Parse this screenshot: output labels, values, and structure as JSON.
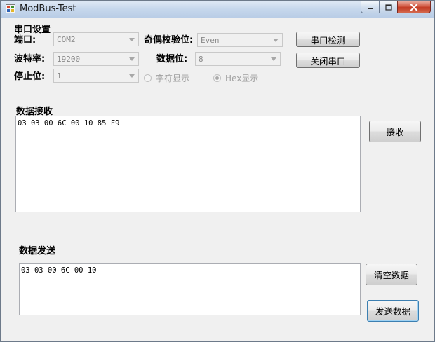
{
  "window": {
    "title": "ModBus-Test"
  },
  "serial_settings": {
    "group_title": "串口设置",
    "port_label": "端口:",
    "port_value": "COM2",
    "baud_label": "波特率:",
    "baud_value": "19200",
    "stop_label": "停止位:",
    "stop_value": "1",
    "parity_label": "奇偶校验位:",
    "parity_value": "Even",
    "databits_label": "数据位:",
    "databits_value": "8",
    "detect_button": "串口检测",
    "close_port_button": "关闭串口",
    "char_display_label": "字符显示",
    "hex_display_label": "Hex显示"
  },
  "receive": {
    "title": "数据接收",
    "content": "03 03 00 6C 00 10 85 F9",
    "receive_button": "接收"
  },
  "send": {
    "title": "数据发送",
    "content": "03 03 00 6C 00 10",
    "clear_button": "清空数据",
    "send_button": "发送数据"
  }
}
